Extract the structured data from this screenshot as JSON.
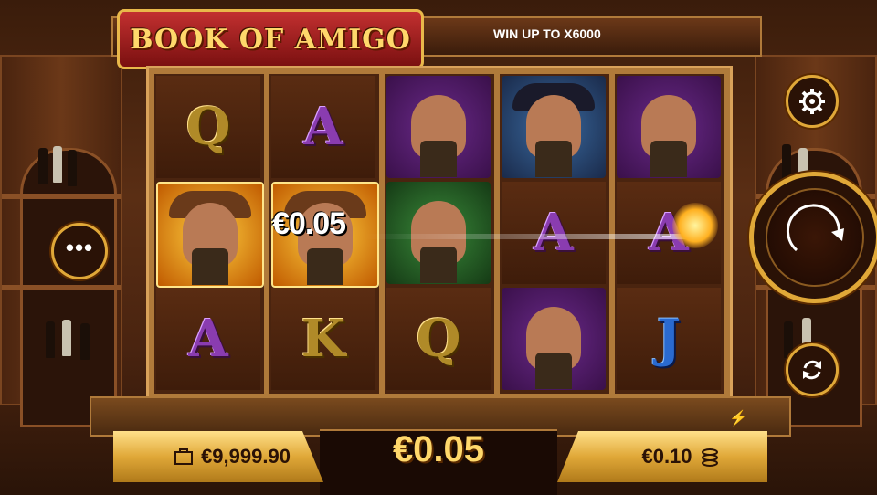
{
  "game": {
    "title": "BOOK OF AMIGO",
    "win_up_to": "WIN UP TO X6000"
  },
  "reels": [
    [
      {
        "type": "letter",
        "value": "Q",
        "color": "gold"
      },
      {
        "type": "character",
        "name": "cowboy",
        "bg": "yellow"
      },
      {
        "type": "letter",
        "value": "A",
        "color": "purple"
      }
    ],
    [
      {
        "type": "letter",
        "value": "A",
        "color": "purple"
      },
      {
        "type": "character",
        "name": "cowboy",
        "bg": "yellow"
      },
      {
        "type": "letter",
        "value": "K",
        "color": "gold"
      }
    ],
    [
      {
        "type": "character",
        "name": "bald-bandit",
        "bg": "purple"
      },
      {
        "type": "character",
        "name": "woman",
        "bg": "green"
      },
      {
        "type": "letter",
        "value": "Q",
        "color": "gold"
      }
    ],
    [
      {
        "type": "character",
        "name": "masked-gunman",
        "bg": "blue"
      },
      {
        "type": "letter",
        "value": "A",
        "color": "purple"
      },
      {
        "type": "character",
        "name": "bald-bandit",
        "bg": "purple"
      }
    ],
    [
      {
        "type": "character",
        "name": "bald-bandit",
        "bg": "purple"
      },
      {
        "type": "letter",
        "value": "A",
        "color": "purple"
      },
      {
        "type": "letter",
        "value": "J",
        "color": "blue"
      }
    ]
  ],
  "line_win": "€0.05",
  "balance": "€9,999.90",
  "win": "€0.05",
  "bet": "€0.10",
  "icons": {
    "settings": "gear-icon",
    "spin": "spin-arrow-icon",
    "autoplay": "autoplay-icon",
    "menu": "more-dots-icon",
    "balance": "wallet-icon",
    "bet": "coins-icon",
    "turbo": "lightning-icon"
  },
  "colors": {
    "accent": "#e0a838",
    "logo_red": "#c23030",
    "letter_purple": "#8a3cb0"
  }
}
